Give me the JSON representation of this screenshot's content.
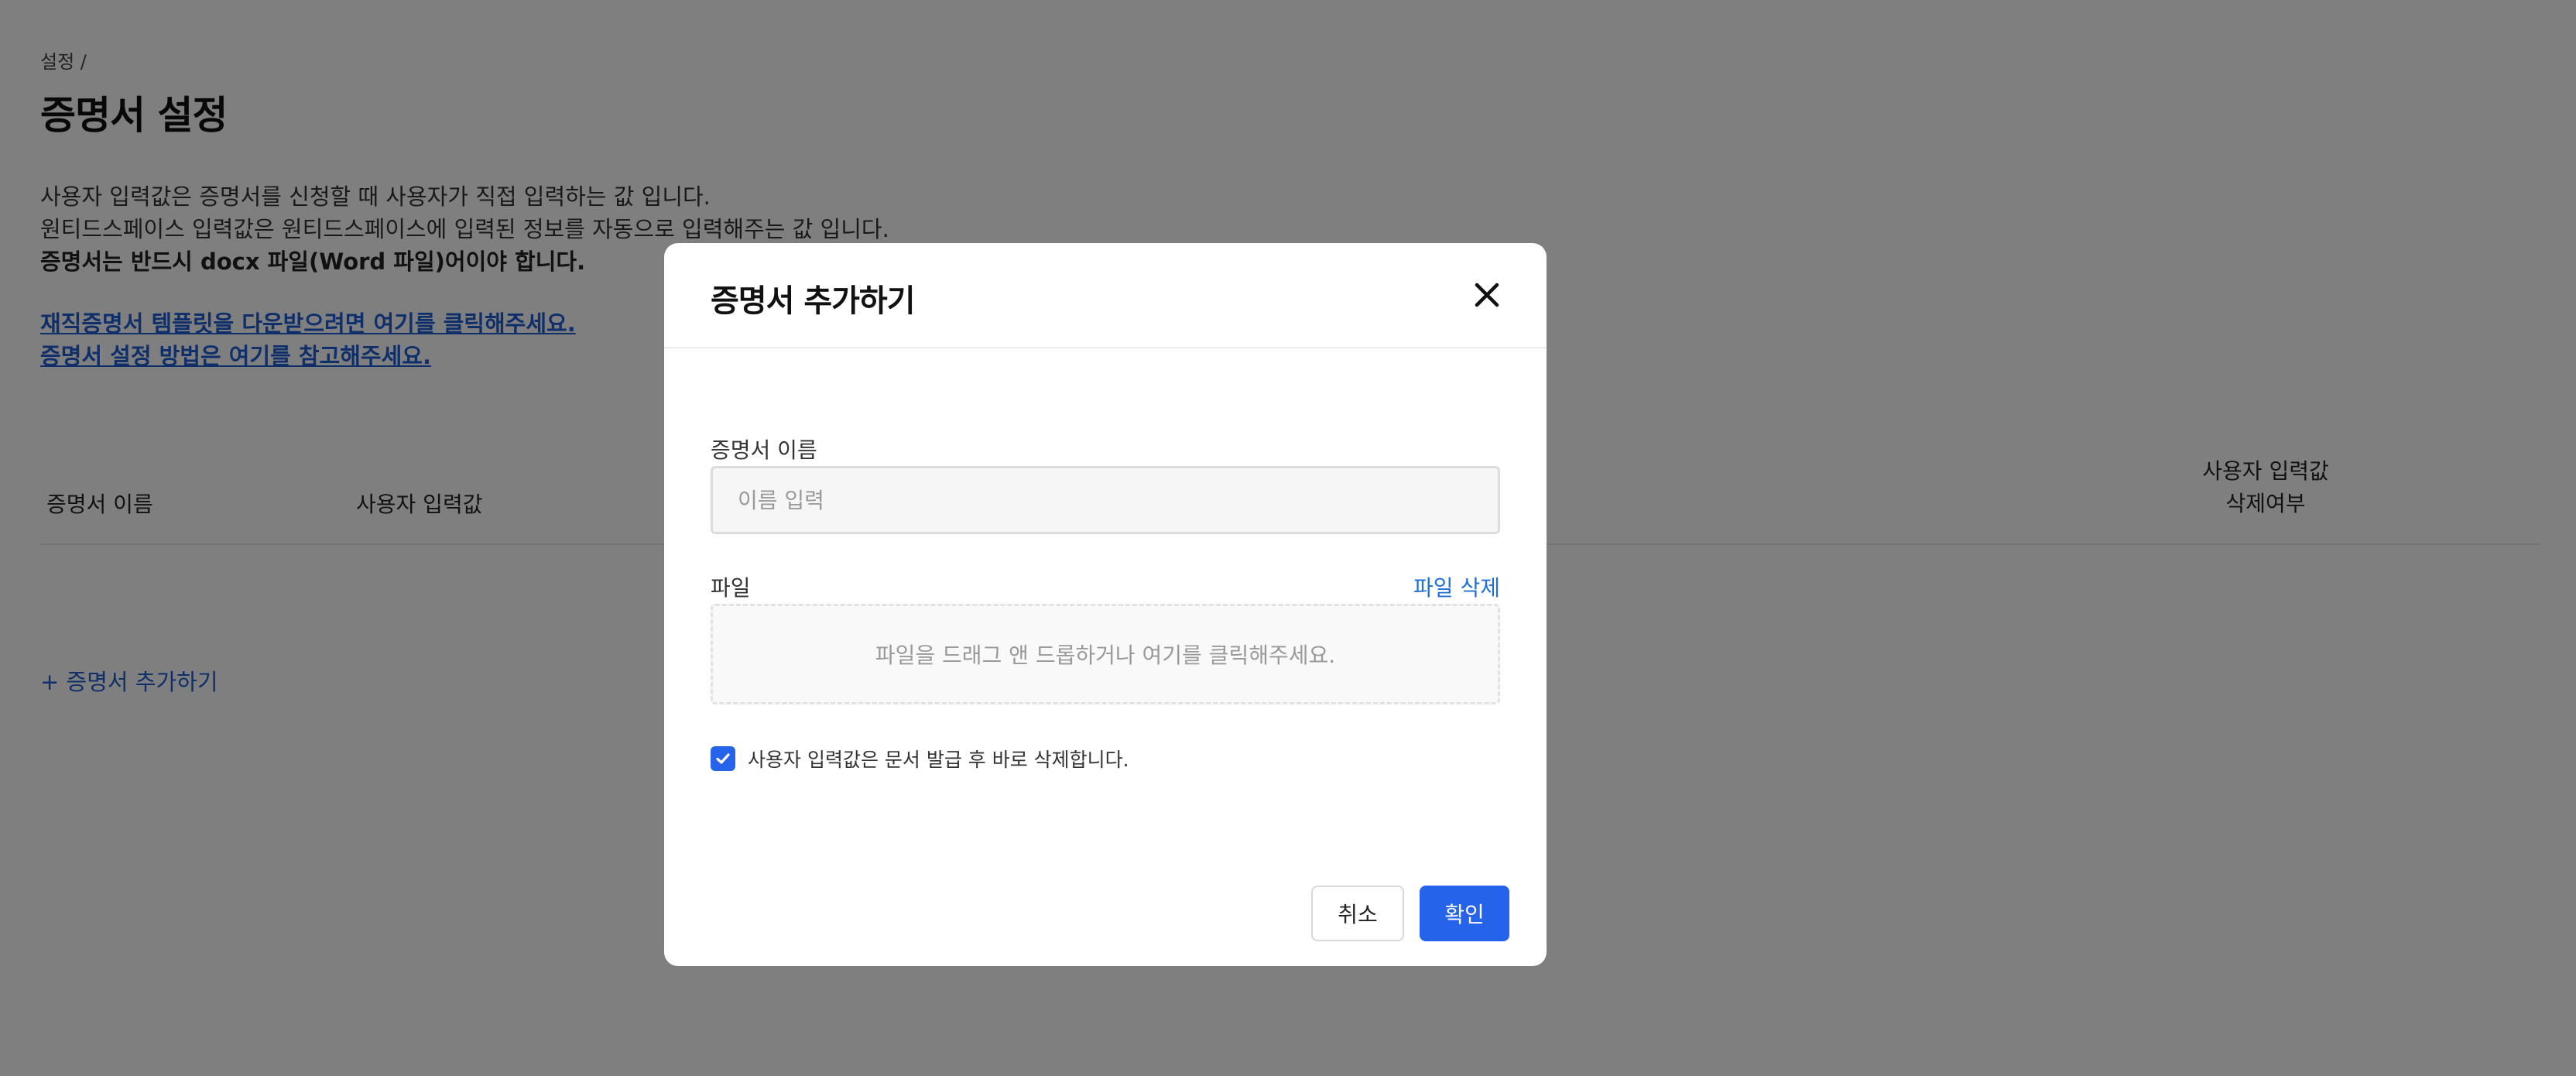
{
  "breadcrumb": "설정 /",
  "page_title": "증명서 설정",
  "description": {
    "line1": "사용자 입력값은 증명서를 신청할 때 사용자가 직접 입력하는 값 입니다.",
    "line2": "원티드스페이스 입력값은 원티드스페이스에 입력된 정보를 자동으로 입력해주는 값 입니다.",
    "line3": "증명서는 반드시 docx 파일(Word 파일)어이야 합니다."
  },
  "links": {
    "template_download": "재직증명서 템플릿을 다운받으려면 여기를 클릭해주세요.",
    "setup_guide": "증명서 설정 방법은 여기를 참고해주세요."
  },
  "table": {
    "headers": {
      "name": "증명서 이름",
      "user_input": "사용자 입력값",
      "delete_user_input": "사용자 입력값 삭제여부"
    }
  },
  "add_certificate_link": "+ 증명서 추가하기",
  "modal": {
    "title": "증명서 추가하기",
    "name_label": "증명서 이름",
    "name_placeholder": "이름 입력",
    "name_value": "",
    "file_label": "파일",
    "file_delete": "파일 삭제",
    "dropzone_text": "파일을 드래그 앤 드롭하거나 여기를 클릭해주세요.",
    "checkbox_checked": true,
    "checkbox_label": "사용자 입력값은 문서 발급 후 바로 삭제합니다.",
    "cancel": "취소",
    "confirm": "확인"
  },
  "colors": {
    "accent": "#2563eb",
    "link": "#1f5fd6",
    "overlay": "rgba(0,0,0,0.5)"
  }
}
